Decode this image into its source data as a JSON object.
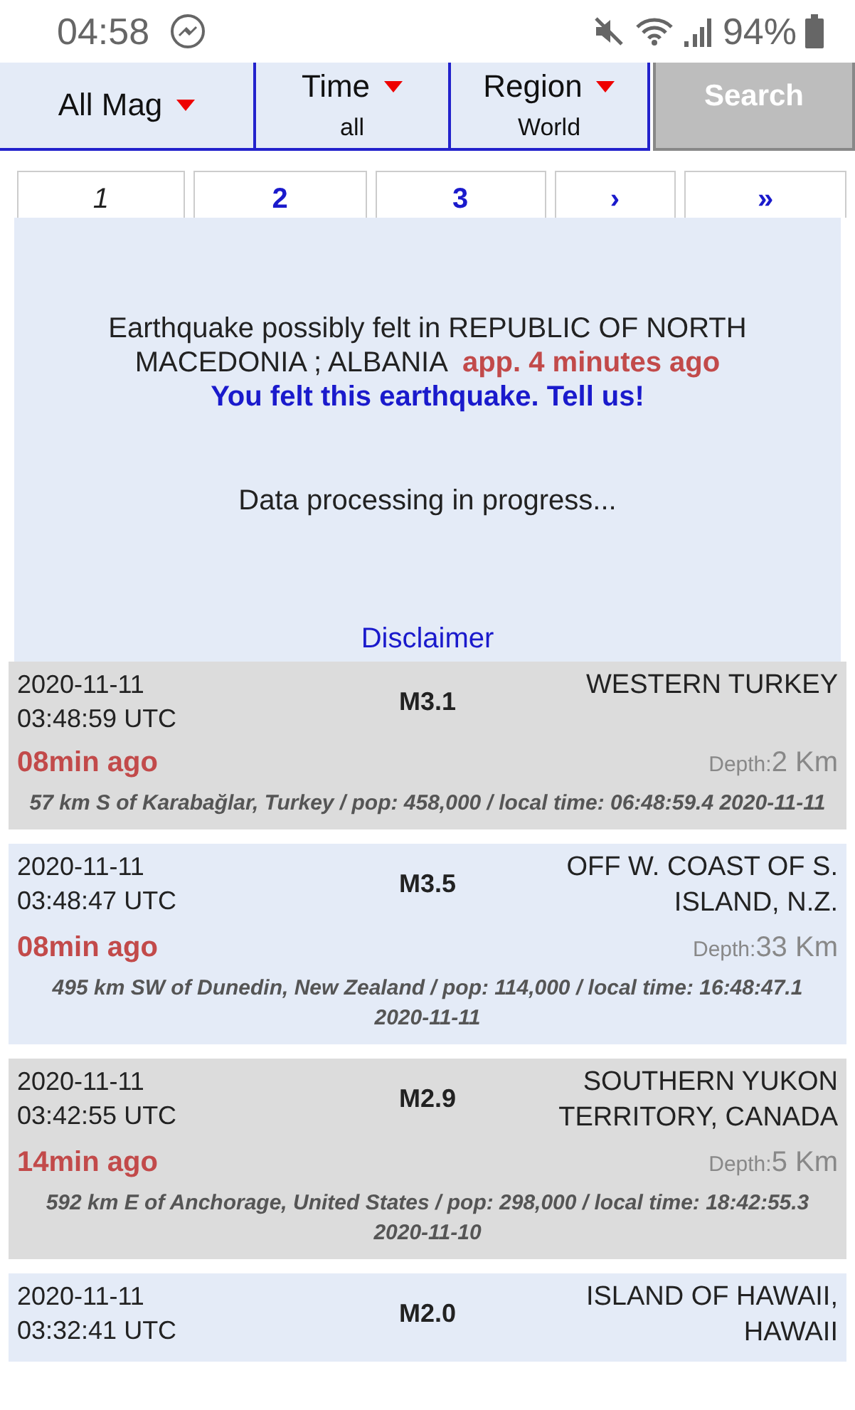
{
  "status_bar": {
    "time": "04:58",
    "battery": "94%"
  },
  "filters": [
    {
      "label": "All Mag"
    },
    {
      "label": "Time",
      "value": "all"
    },
    {
      "label": "Region",
      "value": "World"
    }
  ],
  "search_button": "Search",
  "pagination": [
    {
      "label": "1",
      "selected": true
    },
    {
      "label": "2",
      "selected": false
    },
    {
      "label": "3",
      "selected": false
    },
    {
      "label": "›",
      "selected": false
    },
    {
      "label": "»",
      "selected": false
    }
  ],
  "felt_popup": {
    "message": "Earthquake possibly felt in REPUBLIC OF NORTH MACEDONIA ; ALBANIA",
    "age": "app. 4 minutes ago",
    "felt_link": "You felt this earthquake. Tell us!",
    "status": "Data processing in progress...",
    "disclaimer": "Disclaimer"
  },
  "quakes": [
    {
      "date": "2020-11-11",
      "time": "03:48:59 UTC",
      "magnitude": "M3.1",
      "region": "WESTERN TURKEY",
      "ago": "08min ago",
      "depth_label": "Depth:",
      "depth": "2 Km",
      "details": "57 km S of Karabağlar, Turkey / pop: 458,000 / local time: 06:48:59.4 2020-11-11"
    },
    {
      "date": "2020-11-11",
      "time": "03:48:47 UTC",
      "magnitude": "M3.5",
      "region": "OFF W. COAST OF S. ISLAND, N.Z.",
      "ago": "08min ago",
      "depth_label": "Depth:",
      "depth": "33 Km",
      "details": "495 km SW of Dunedin, New Zealand / pop: 114,000 / local time: 16:48:47.1 2020-11-11"
    },
    {
      "date": "2020-11-11",
      "time": "03:42:55 UTC",
      "magnitude": "M2.9",
      "region": "SOUTHERN YUKON TERRITORY, CANADA",
      "ago": "14min ago",
      "depth_label": "Depth:",
      "depth": "5 Km",
      "details": "592 km E of Anchorage, United States / pop: 298,000 / local time: 18:42:55.3 2020-11-10"
    },
    {
      "date": "2020-11-11",
      "time": "03:32:41 UTC",
      "magnitude": "M2.0",
      "region": "ISLAND OF HAWAII, HAWAII"
    }
  ]
}
